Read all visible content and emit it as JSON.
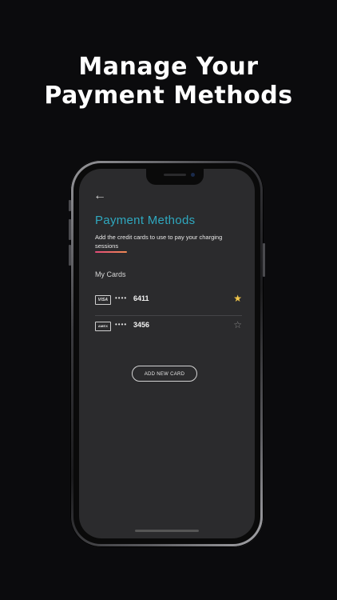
{
  "marketing": {
    "headline_line1": "Manage Your",
    "headline_line2": "Payment Methods"
  },
  "screen": {
    "back_icon": "←",
    "title": "Payment Methods",
    "subtitle": "Add the credit cards to use to pay your charging sessions",
    "section_label": "My Cards",
    "cards": [
      {
        "brand": "VISA",
        "masked": "•••• ",
        "last4": "6411",
        "default": true,
        "star": "★",
        "star_icon": "star-filled-icon"
      },
      {
        "brand": "AMEX",
        "masked": "•••• ",
        "last4": "3456",
        "default": false,
        "star": "☆",
        "star_icon": "star-outline-icon"
      }
    ],
    "add_card_label": "ADD NEW CARD"
  },
  "colors": {
    "background": "#0b0b0d",
    "screen_bg": "#2b2b2d",
    "title_accent": "#2fa8bf",
    "underline_gradient_start": "#e24a79",
    "underline_gradient_end": "#f08a54",
    "star_active": "#f0c64a"
  }
}
